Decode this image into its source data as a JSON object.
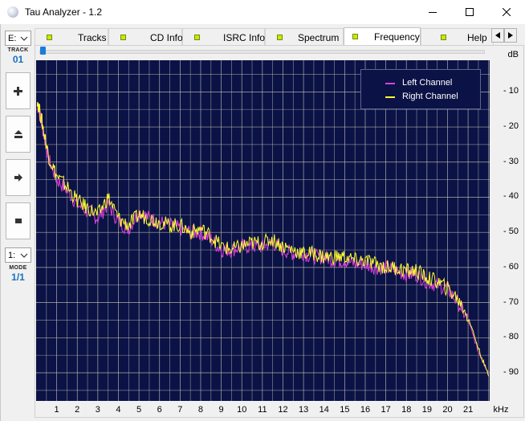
{
  "window": {
    "title": "Tau Analyzer - 1.2"
  },
  "left_panel": {
    "drive": {
      "value": "E:"
    },
    "track_label": "TRACK",
    "track_value": "01",
    "buttons": [
      {
        "name": "next-track-button",
        "icon": "plus-icon"
      },
      {
        "name": "eject-button",
        "icon": "eject-icon"
      },
      {
        "name": "play-button",
        "icon": "arrow-right-icon"
      },
      {
        "name": "stop-button",
        "icon": "stop-icon"
      }
    ],
    "mode_select": {
      "value": "1:"
    },
    "mode_label": "MODE",
    "mode_value": "1/1"
  },
  "tabs": [
    {
      "label": "Tracks",
      "active": false
    },
    {
      "label": "CD Info",
      "active": false
    },
    {
      "label": "ISRC Info",
      "active": false
    },
    {
      "label": "Spectrum",
      "active": false
    },
    {
      "label": "Frequency",
      "active": true
    },
    {
      "label": "Help",
      "active": false
    }
  ],
  "colors": {
    "plot_bg": "#0b1246",
    "grid": "#c8c8b4",
    "left_channel": "#e040e0",
    "right_channel": "#ffff30",
    "accent": "#1a6fc0"
  },
  "chart_data": {
    "type": "line",
    "title": "",
    "xlabel": "kHz",
    "ylabel": "dB",
    "xlim": [
      0,
      22.05
    ],
    "ylim": [
      -98,
      -1
    ],
    "x_ticks": [
      "1",
      "2",
      "3",
      "4",
      "5",
      "6",
      "7",
      "8",
      "9",
      "10",
      "11",
      "12",
      "13",
      "14",
      "15",
      "16",
      "17",
      "18",
      "19",
      "20",
      "21"
    ],
    "y_ticks": [
      "10",
      "20",
      "30",
      "40",
      "50",
      "60",
      "70",
      "80",
      "90"
    ],
    "grid": true,
    "legend_position": "top-right",
    "series": [
      {
        "name": "Left Channel",
        "x": [
          0.05,
          0.3,
          0.6,
          1,
          1.5,
          2,
          2.5,
          3,
          3.5,
          4,
          4.5,
          5,
          5.5,
          6,
          6.5,
          7,
          7.5,
          8,
          8.5,
          9,
          9.5,
          10,
          10.5,
          11,
          11.5,
          12,
          12.5,
          13,
          13.5,
          14,
          14.5,
          15,
          15.5,
          16,
          16.5,
          17,
          17.5,
          18,
          18.5,
          19,
          19.5,
          20,
          20.5,
          21,
          21.5,
          22
        ],
        "y": [
          -13,
          -20,
          -29,
          -35,
          -38,
          -42,
          -44,
          -46,
          -42,
          -47,
          -49,
          -44,
          -46,
          -47,
          -48,
          -49,
          -50,
          -50,
          -52,
          -55,
          -55,
          -54,
          -54,
          -54,
          -53,
          -55,
          -56,
          -56,
          -57,
          -57,
          -58,
          -58,
          -59,
          -59,
          -60,
          -60,
          -61,
          -62,
          -62,
          -64,
          -65,
          -66,
          -70,
          -75,
          -84,
          -90
        ]
      },
      {
        "name": "Right Channel",
        "x": [
          0.05,
          0.3,
          0.6,
          1,
          1.5,
          2,
          2.5,
          3,
          3.5,
          4,
          4.5,
          5,
          5.5,
          6,
          6.5,
          7,
          7.5,
          8,
          8.5,
          9,
          9.5,
          10,
          10.5,
          11,
          11.5,
          12,
          12.5,
          13,
          13.5,
          14,
          14.5,
          15,
          15.5,
          16,
          16.5,
          17,
          17.5,
          18,
          18.5,
          19,
          19.5,
          20,
          20.5,
          21,
          21.5,
          22
        ],
        "y": [
          -12,
          -19,
          -28,
          -34,
          -37,
          -41,
          -43,
          -45,
          -40,
          -46,
          -48,
          -45,
          -46,
          -47,
          -48,
          -48,
          -50,
          -49,
          -51,
          -54,
          -55,
          -54,
          -53,
          -53,
          -52,
          -54,
          -55,
          -56,
          -56,
          -57,
          -57,
          -57,
          -58,
          -58,
          -59,
          -60,
          -60,
          -61,
          -61,
          -63,
          -64,
          -66,
          -69,
          -74,
          -83,
          -91
        ]
      }
    ]
  }
}
